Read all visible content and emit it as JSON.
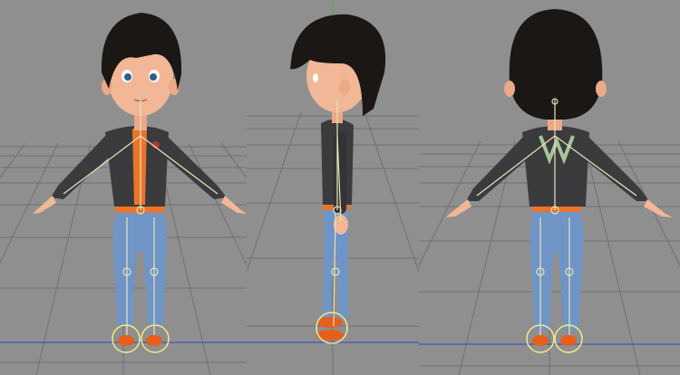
{
  "viewport": {
    "background": "#8f8f8f",
    "grid_color": "#6e6e6e",
    "rig_color": "#e9e4b8",
    "control_ring_color": "#f2ea8c",
    "x_axis_color": "#3d56b8",
    "y_axis_color": "#3fae4a"
  },
  "views": [
    {
      "name": "front"
    },
    {
      "name": "side"
    },
    {
      "name": "back"
    }
  ],
  "character": {
    "hair_color": "#1b1714",
    "skin_color": "#f1b796",
    "jacket_color": "#3b3b3e",
    "shirt_color": "#e9742a",
    "jeans_color": "#6f95c6",
    "shoe_color": "#e65f1c"
  }
}
